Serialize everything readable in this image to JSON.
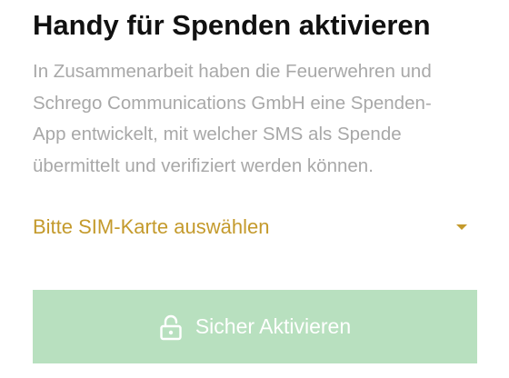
{
  "header": {
    "title": "Handy für Spenden aktivieren"
  },
  "description": {
    "lines": [
      "In Zusammenarbeit haben die Feuerwehren und",
      "Schrego Communications GmbH eine Spenden-",
      "App entwickelt, mit welcher SMS als Spende",
      "übermittelt und verifiziert werden können."
    ]
  },
  "sim_select": {
    "label": "Bitte SIM-Karte auswählen",
    "icon": "caret-down-icon"
  },
  "activate_button": {
    "label": "Sicher Aktivieren",
    "icon": "lock-open-icon"
  },
  "colors": {
    "title": "#111111",
    "description": "#a8a8a8",
    "accent": "#c49a2c",
    "button_background": "#b8e0bf",
    "button_text": "#ffffff"
  }
}
